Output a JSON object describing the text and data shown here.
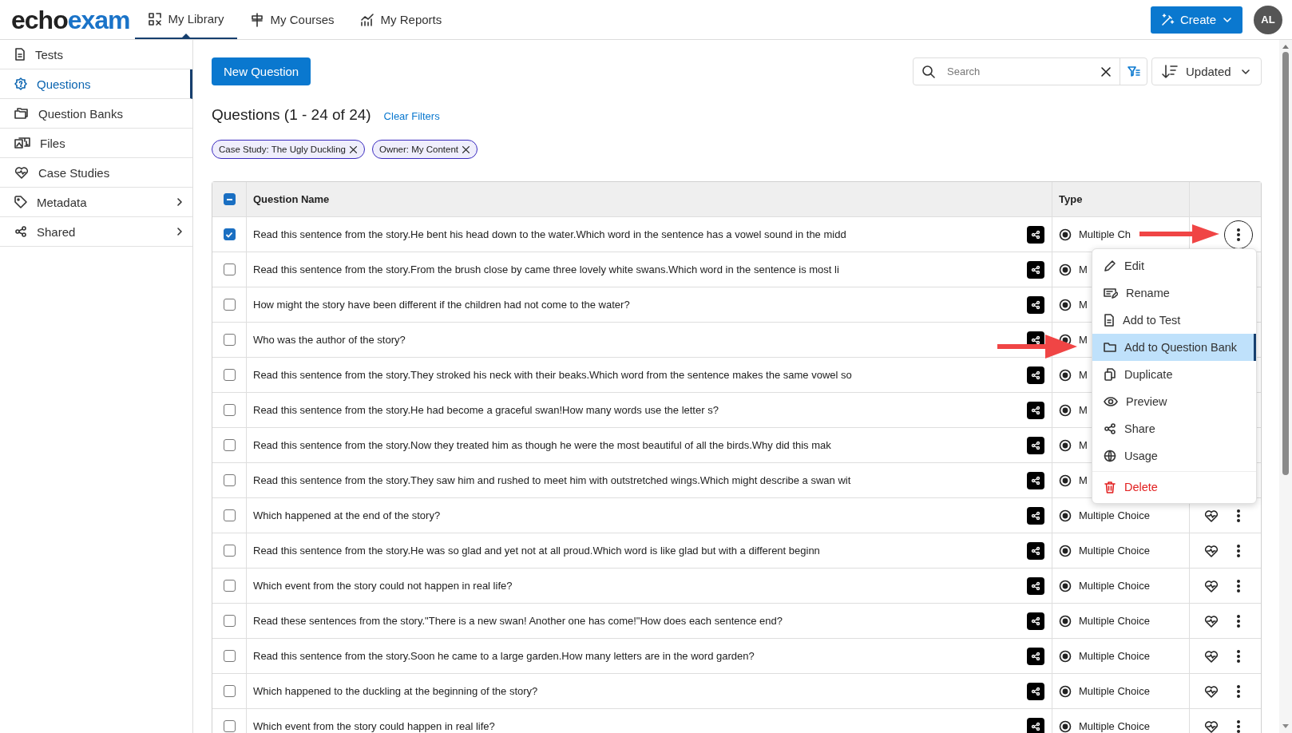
{
  "logo": {
    "dark": "echo",
    "accent": "exam"
  },
  "nav_tabs": [
    {
      "label": "My Library",
      "selected": true
    },
    {
      "label": "My Courses",
      "selected": false
    },
    {
      "label": "My Reports",
      "selected": false
    }
  ],
  "create_button": "Create",
  "avatar": "AL",
  "sidebar": {
    "items": [
      {
        "label": "Tests",
        "selected": false,
        "has_submenu": false
      },
      {
        "label": "Questions",
        "selected": true,
        "has_submenu": false
      },
      {
        "label": "Question Banks",
        "selected": false,
        "has_submenu": false
      },
      {
        "label": "Files",
        "selected": false,
        "has_submenu": false
      },
      {
        "label": "Case Studies",
        "selected": false,
        "has_submenu": false
      },
      {
        "label": "Metadata",
        "selected": false,
        "has_submenu": true
      },
      {
        "label": "Shared",
        "selected": false,
        "has_submenu": true
      }
    ]
  },
  "new_question_button": "New Question",
  "search": {
    "placeholder": "Search"
  },
  "sort": {
    "label": "Updated"
  },
  "heading": "Questions (1 - 24 of 24)",
  "clear_filters": "Clear Filters",
  "filters": [
    "Case Study: The Ugly Duckling",
    "Owner: My Content"
  ],
  "table": {
    "select_all": {
      "indeterminate": true
    },
    "columns": [
      "Question Name",
      "Type"
    ],
    "rows": [
      {
        "checked": true,
        "name": "Read this sentence from the story.He bent his head down to the water.Which word in the sentence has a vowel sound in the midd",
        "type": "Multiple Ch",
        "case_study_icon": false,
        "more_button": true,
        "menu_open": true
      },
      {
        "checked": false,
        "name": "Read this sentence from the story.From the brush close by came three lovely white swans.Which word in the sentence is most li",
        "type": "M",
        "case_study_icon": false,
        "more_button": false,
        "menu_open": false
      },
      {
        "checked": false,
        "name": "How might the story have been different if the children had not come to the water?",
        "type": "M",
        "case_study_icon": false,
        "more_button": false,
        "menu_open": false
      },
      {
        "checked": false,
        "name": "Who was the author of the story?",
        "type": "M",
        "case_study_icon": false,
        "more_button": false,
        "menu_open": false
      },
      {
        "checked": false,
        "name": "Read this sentence from the story.They stroked his neck with their beaks.Which word from the sentence makes the same vowel so",
        "type": "M",
        "case_study_icon": false,
        "more_button": false,
        "menu_open": false
      },
      {
        "checked": false,
        "name": "Read this sentence from the story.He had become a graceful swan!How many words use the letter s?",
        "type": "M",
        "case_study_icon": false,
        "more_button": false,
        "menu_open": false
      },
      {
        "checked": false,
        "name": "Read this sentence from the story.Now they treated him as though he were the most beautiful of all the birds.Why did this mak",
        "type": "M",
        "case_study_icon": false,
        "more_button": false,
        "menu_open": false
      },
      {
        "checked": false,
        "name": "Read this sentence from the story.They saw him and rushed to meet him with outstretched wings.Which might describe a swan wit",
        "type": "M",
        "case_study_icon": false,
        "more_button": false,
        "menu_open": false
      },
      {
        "checked": false,
        "name": "Which happened at the end of the story?",
        "type": "Multiple Choice",
        "case_study_icon": true,
        "more_button": true,
        "menu_open": false
      },
      {
        "checked": false,
        "name": "Read this sentence from the story.He was so glad and yet not at all proud.Which word is like glad but with a different beginn",
        "type": "Multiple Choice",
        "case_study_icon": true,
        "more_button": true,
        "menu_open": false
      },
      {
        "checked": false,
        "name": "Which event from the story could not happen in real life?",
        "type": "Multiple Choice",
        "case_study_icon": true,
        "more_button": true,
        "menu_open": false
      },
      {
        "checked": false,
        "name": "Read these sentences from the story.\"There is a new swan! Another one has come!\"How does each sentence end?",
        "type": "Multiple Choice",
        "case_study_icon": true,
        "more_button": true,
        "menu_open": false
      },
      {
        "checked": false,
        "name": "Read this sentence from the story.Soon he came to a large garden.How many letters are in the word garden?",
        "type": "Multiple Choice",
        "case_study_icon": true,
        "more_button": true,
        "menu_open": false
      },
      {
        "checked": false,
        "name": "Which happened to the duckling at the beginning of the story?",
        "type": "Multiple Choice",
        "case_study_icon": true,
        "more_button": true,
        "menu_open": false
      },
      {
        "checked": false,
        "name": "Which event from the story could happen in real life?",
        "type": "Multiple Choice",
        "case_study_icon": true,
        "more_button": true,
        "menu_open": false
      }
    ]
  },
  "context_menu": {
    "items": [
      {
        "label": "Edit",
        "kind": "normal",
        "selected": false
      },
      {
        "label": "Rename",
        "kind": "normal",
        "selected": false
      },
      {
        "label": "Add to Test",
        "kind": "normal",
        "selected": false
      },
      {
        "label": "Add to Question Bank",
        "kind": "normal",
        "selected": true
      },
      {
        "label": "Duplicate",
        "kind": "normal",
        "selected": false
      },
      {
        "label": "Preview",
        "kind": "normal",
        "selected": false
      },
      {
        "label": "Share",
        "kind": "normal",
        "selected": false
      },
      {
        "label": "Usage",
        "kind": "normal",
        "selected": false
      },
      {
        "label": "Delete",
        "kind": "danger",
        "selected": false
      }
    ]
  }
}
